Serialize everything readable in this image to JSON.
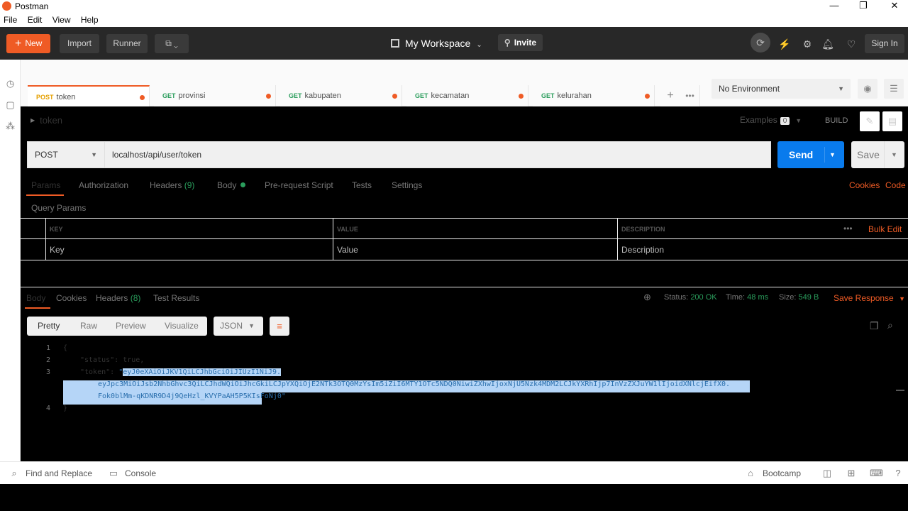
{
  "window": {
    "title": "Postman",
    "min": "—",
    "max": "❐",
    "close": "✕"
  },
  "menu": [
    "File",
    "Edit",
    "View",
    "Help"
  ],
  "header": {
    "new_label": "New",
    "import_label": "Import",
    "runner_label": "Runner",
    "workspace_label": "My Workspace",
    "invite_label": "Invite",
    "signin_label": "Sign In"
  },
  "tabs": [
    {
      "method": "POST",
      "name": "token"
    },
    {
      "method": "GET",
      "name": "provinsi"
    },
    {
      "method": "GET",
      "name": "kabupaten"
    },
    {
      "method": "GET",
      "name": "kecamatan"
    },
    {
      "method": "GET",
      "name": "kelurahan"
    }
  ],
  "environment": {
    "selected": "No Environment"
  },
  "request": {
    "name": "token",
    "examples_label": "Examples",
    "examples_count": "0",
    "build_label": "BUILD",
    "method": "POST",
    "url": "localhost/api/user/token",
    "send_label": "Send",
    "save_label": "Save"
  },
  "request_tabs": {
    "params": "Params",
    "authorization": "Authorization",
    "headers": "Headers",
    "headers_count": "(9)",
    "body": "Body",
    "prerequest": "Pre-request Script",
    "tests": "Tests",
    "settings": "Settings",
    "cookies": "Cookies",
    "code": "Code"
  },
  "query_params": {
    "title": "Query Params",
    "col_key": "KEY",
    "col_value": "VALUE",
    "col_description": "DESCRIPTION",
    "bulk_edit": "Bulk Edit",
    "ph_key": "Key",
    "ph_value": "Value",
    "ph_description": "Description"
  },
  "response": {
    "tab_body": "Body",
    "tab_cookies": "Cookies",
    "tab_headers": "Headers",
    "headers_count": "(8)",
    "tab_tests": "Test Results",
    "status_label": "Status:",
    "status_value": "200 OK",
    "time_label": "Time:",
    "time_value": "48 ms",
    "size_label": "Size:",
    "size_value": "549 B",
    "save_response": "Save Response",
    "view_pretty": "Pretty",
    "view_raw": "Raw",
    "view_preview": "Preview",
    "view_visualize": "Visualize",
    "format": "JSON",
    "lines": {
      "l1": "{",
      "l2_key": "\"status\"",
      "l2_val": "true,",
      "l3_key": "\"token\"",
      "token_part1": "eyJ0eXAiOiJKV1QiLCJhbGciOiJIUzI1NiJ9.",
      "token_part2": "eyJpc3MiOiJsb2NhbGhvc3QiLCJhdWQiOiJhcGkiLCJpYXQiOjE2NTk3OTQ0MzYsIm5iZiI6MTY1OTc5NDQ0NiwiZXhwIjoxNjU5Nzk4MDM2LCJkYXRhIjp7InVzZXJuYW1lIjoidXNlcjEifX0.",
      "token_part3": "Fok0blMm-qKDNR9D4j9QeHzl_KVYPaAH5P5KIsFoNj0",
      "l4": "}"
    }
  },
  "footer": {
    "find_replace": "Find and Replace",
    "console": "Console",
    "bootcamp": "Bootcamp"
  }
}
